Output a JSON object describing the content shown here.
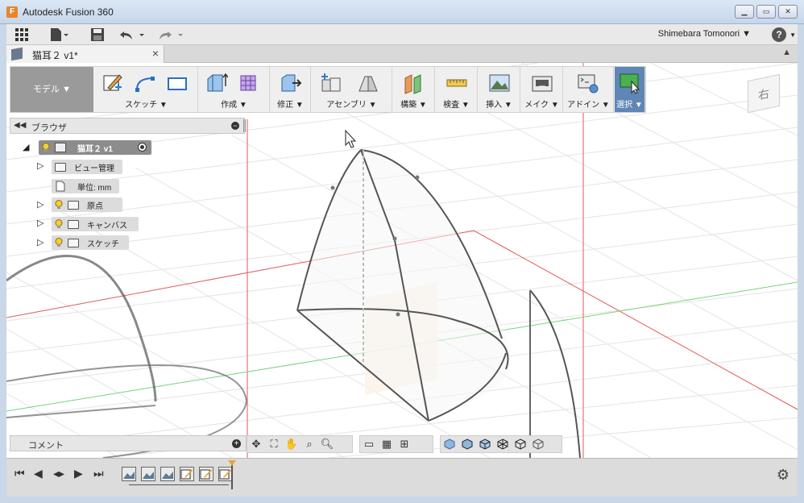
{
  "window": {
    "title": "Autodesk Fusion 360",
    "app_icon": "F"
  },
  "quick_access": {
    "user": "Shimebara Tomonori",
    "help": "?"
  },
  "document": {
    "tab_title": "猫耳２ v1*",
    "close": "×"
  },
  "ribbon": {
    "mode": "モデル",
    "groups": [
      {
        "label": "スケッチ"
      },
      {
        "label": "作成"
      },
      {
        "label": "修正"
      },
      {
        "label": "アセンブリ"
      },
      {
        "label": "構築"
      },
      {
        "label": "検査"
      },
      {
        "label": "挿入"
      },
      {
        "label": "メイク"
      },
      {
        "label": "アドイン"
      },
      {
        "label": "選択"
      }
    ]
  },
  "viewcube": {
    "face": "右"
  },
  "browser": {
    "title": "ブラウザ",
    "root": "猫耳２ v1",
    "items": [
      {
        "label": "ビュー管理"
      },
      {
        "label": "単位: mm"
      },
      {
        "label": "原点"
      },
      {
        "label": "キャンバス"
      },
      {
        "label": "スケッチ"
      }
    ]
  },
  "comment": {
    "title": "コメント"
  },
  "colors": {
    "accent": "#5f86b6",
    "ribbon_bg": "#efefef",
    "mode_bg": "#9a9a9a",
    "grid_red": "#e05050",
    "grid_green": "#4caf50"
  }
}
